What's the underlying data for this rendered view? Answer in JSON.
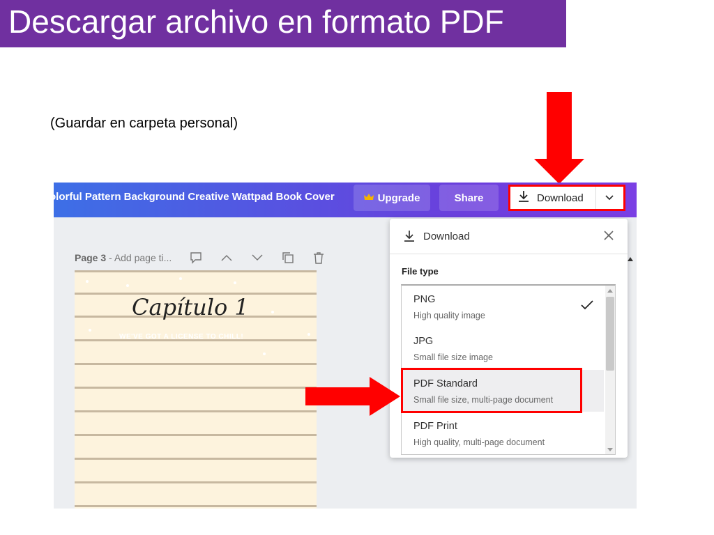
{
  "slide": {
    "title": "Descargar archivo en formato PDF",
    "subtitle": "(Guardar en carpeta personal)",
    "accent_color": "#7030a0",
    "highlight_color": "#ff0000"
  },
  "editor": {
    "doc_title": "olorful Pattern Background Creative Wattpad Book Cover",
    "upgrade_label": "Upgrade",
    "upgrade_icon": "crown-icon",
    "share_label": "Share",
    "download_label": "Download",
    "download_icon": "download-icon",
    "dropdown_icon": "chevron-down-icon"
  },
  "page_toolbar": {
    "page_label": "Page 3",
    "separator": " - ",
    "page_title_placeholder": "Add page ti...",
    "icons": [
      "comment-icon",
      "chevron-up-icon",
      "chevron-down-icon",
      "duplicate-icon",
      "trash-icon"
    ]
  },
  "design_page": {
    "heading": "Capítulo 1",
    "tagline": "WE'VE GOT A LICENSE TO CHILL!",
    "background_color": "#fdf3dd"
  },
  "download_panel": {
    "title": "Download",
    "close_icon": "close-icon",
    "file_type_label": "File type",
    "options": [
      {
        "name": "PNG",
        "description": "High quality image",
        "selected": true
      },
      {
        "name": "JPG",
        "description": "Small file size image",
        "selected": false
      },
      {
        "name": "PDF Standard",
        "description": "Small file size, multi-page document",
        "selected": false,
        "highlighted": true
      },
      {
        "name": "PDF Print",
        "description": "High quality, multi-page document",
        "selected": false
      }
    ]
  }
}
